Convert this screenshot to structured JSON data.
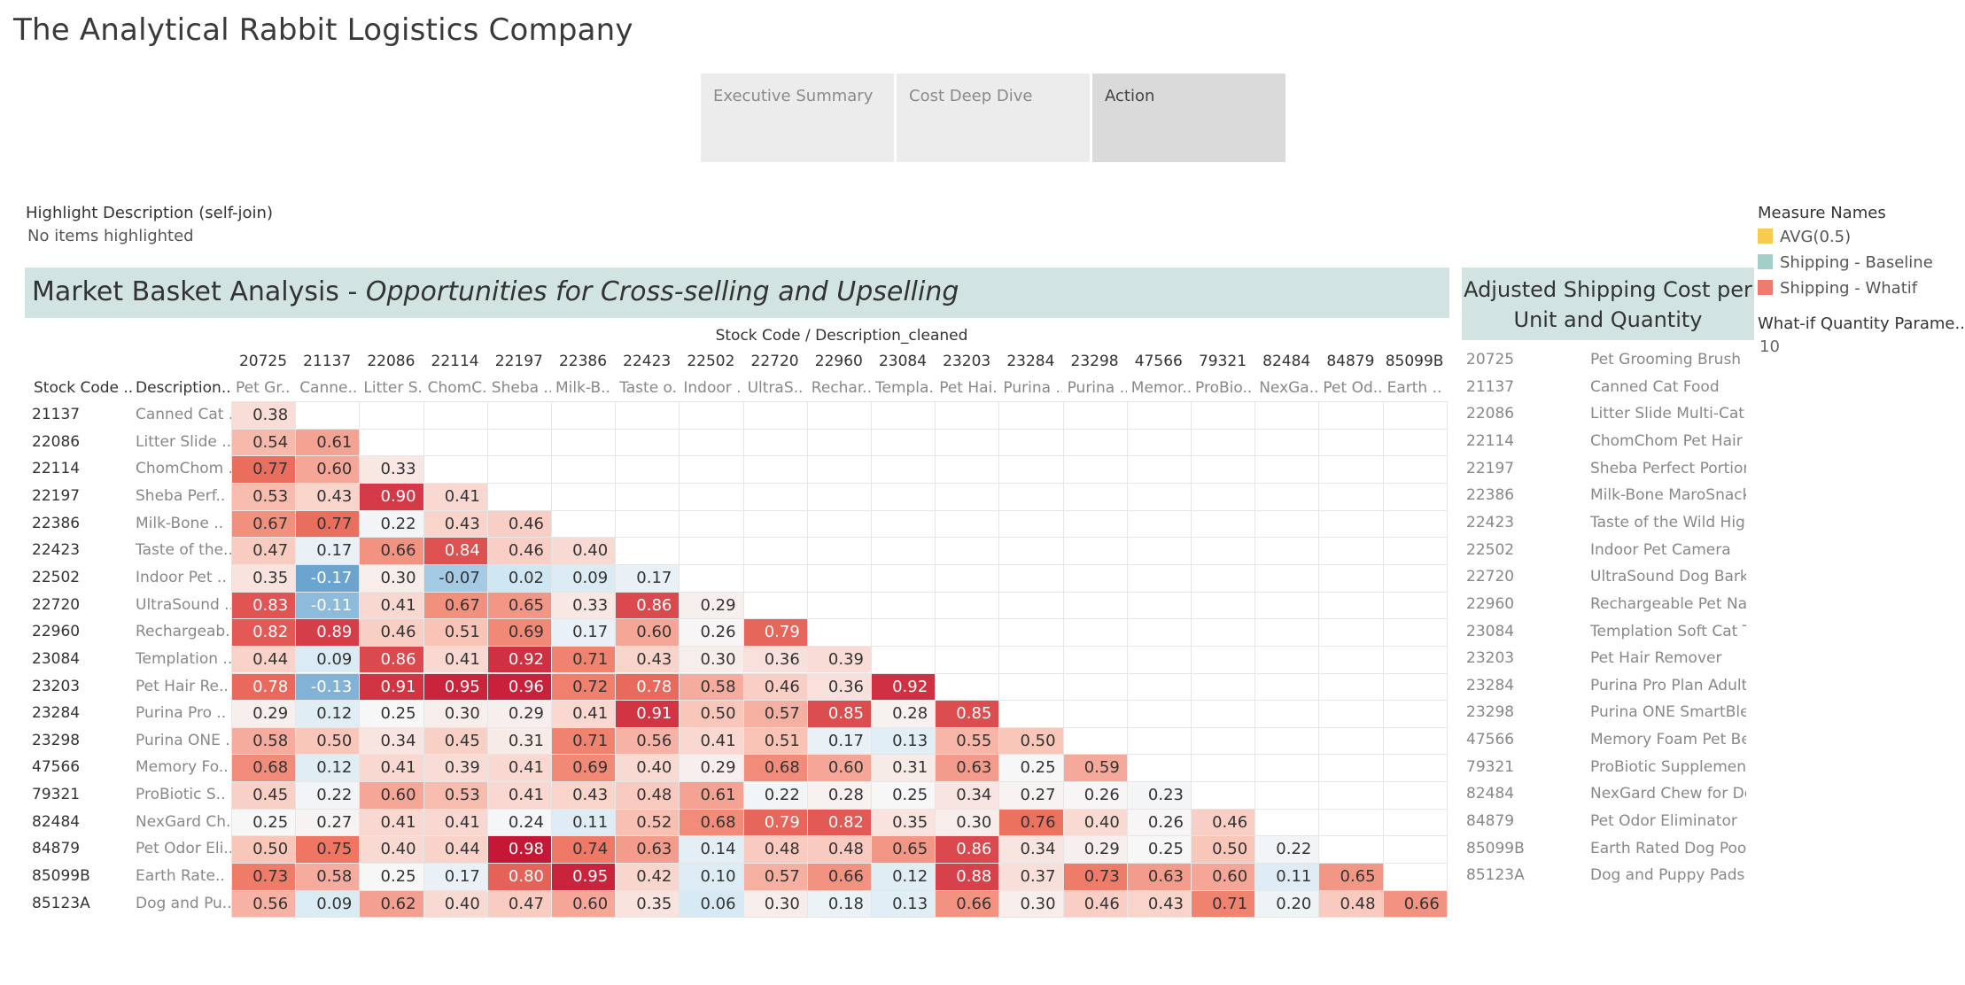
{
  "app_title": "The Analytical Rabbit Logistics Company",
  "nav_tabs": [
    {
      "label": "Executive Summary",
      "active": false
    },
    {
      "label": "Cost Deep Dive",
      "active": false
    },
    {
      "label": "Action",
      "active": true
    }
  ],
  "highlight": {
    "label": "Highlight Description (self-join)",
    "value": "No items highlighted"
  },
  "mba_banner": {
    "title": "Market Basket Analysis - ",
    "subtitle": "Opportunities for Cross-selling and Upselling"
  },
  "shipping_banner": {
    "line1": "Adjusted Shipping Cost per",
    "line2": "Unit and Quantity"
  },
  "legend": {
    "title": "Measure Names",
    "items": [
      {
        "label": "AVG(0.5)",
        "color": "#f6cb4e"
      },
      {
        "label": "Shipping - Baseline",
        "color": "#a3cfc9"
      },
      {
        "label": "Shipping - Whatif",
        "color": "#ef7b6f"
      }
    ]
  },
  "parameter": {
    "title": "What-if Quantity Parame..",
    "value": "10"
  },
  "matrix": {
    "axis_title": "Stock Code  /  Description_cleaned",
    "row_header_code": "Stock Code ..",
    "row_header_desc": "Description..",
    "columns": [
      {
        "code": "20725",
        "desc": "Pet Gr.."
      },
      {
        "code": "21137",
        "desc": "Canne.."
      },
      {
        "code": "22086",
        "desc": "Litter S.."
      },
      {
        "code": "22114",
        "desc": "ChomC.."
      },
      {
        "code": "22197",
        "desc": "Sheba .."
      },
      {
        "code": "22386",
        "desc": "Milk-B.."
      },
      {
        "code": "22423",
        "desc": "Taste o.."
      },
      {
        "code": "22502",
        "desc": "Indoor .."
      },
      {
        "code": "22720",
        "desc": "UltraS.."
      },
      {
        "code": "22960",
        "desc": "Rechar.."
      },
      {
        "code": "23084",
        "desc": "Templa.."
      },
      {
        "code": "23203",
        "desc": "Pet Hai.."
      },
      {
        "code": "23284",
        "desc": "Purina .."
      },
      {
        "code": "23298",
        "desc": "Purina .."
      },
      {
        "code": "47566",
        "desc": "Memor.."
      },
      {
        "code": "79321",
        "desc": "ProBio.."
      },
      {
        "code": "82484",
        "desc": "NexGa.."
      },
      {
        "code": "84879",
        "desc": "Pet Od.."
      },
      {
        "code": "85099B",
        "desc": "Earth .."
      }
    ],
    "rows": [
      {
        "code": "21137",
        "desc": "Canned Cat ..",
        "values": [
          "0.38"
        ]
      },
      {
        "code": "22086",
        "desc": "Litter Slide ..",
        "values": [
          "0.54",
          "0.61"
        ]
      },
      {
        "code": "22114",
        "desc": "ChomChom ..",
        "values": [
          "0.77",
          "0.60",
          "0.33"
        ]
      },
      {
        "code": "22197",
        "desc": "Sheba Perf..",
        "values": [
          "0.53",
          "0.43",
          "0.90",
          "0.41"
        ]
      },
      {
        "code": "22386",
        "desc": "Milk-Bone ..",
        "values": [
          "0.67",
          "0.77",
          "0.22",
          "0.43",
          "0.46"
        ]
      },
      {
        "code": "22423",
        "desc": "Taste of the..",
        "values": [
          "0.47",
          "0.17",
          "0.66",
          "0.84",
          "0.46",
          "0.40"
        ]
      },
      {
        "code": "22502",
        "desc": "Indoor Pet ..",
        "values": [
          "0.35",
          "-0.17",
          "0.30",
          "-0.07",
          "0.02",
          "0.09",
          "0.17"
        ]
      },
      {
        "code": "22720",
        "desc": "UltraSound ..",
        "values": [
          "0.83",
          "-0.11",
          "0.41",
          "0.67",
          "0.65",
          "0.33",
          "0.86",
          "0.29"
        ]
      },
      {
        "code": "22960",
        "desc": "Rechargeab..",
        "values": [
          "0.82",
          "0.89",
          "0.46",
          "0.51",
          "0.69",
          "0.17",
          "0.60",
          "0.26",
          "0.79"
        ]
      },
      {
        "code": "23084",
        "desc": "Templation ..",
        "values": [
          "0.44",
          "0.09",
          "0.86",
          "0.41",
          "0.92",
          "0.71",
          "0.43",
          "0.30",
          "0.36",
          "0.39"
        ]
      },
      {
        "code": "23203",
        "desc": "Pet Hair Re..",
        "values": [
          "0.78",
          "-0.13",
          "0.91",
          "0.95",
          "0.96",
          "0.72",
          "0.78",
          "0.58",
          "0.46",
          "0.36",
          "0.92"
        ]
      },
      {
        "code": "23284",
        "desc": "Purina Pro ..",
        "values": [
          "0.29",
          "0.12",
          "0.25",
          "0.30",
          "0.29",
          "0.41",
          "0.91",
          "0.50",
          "0.57",
          "0.85",
          "0.28",
          "0.85"
        ]
      },
      {
        "code": "23298",
        "desc": "Purina ONE ..",
        "values": [
          "0.58",
          "0.50",
          "0.34",
          "0.45",
          "0.31",
          "0.71",
          "0.56",
          "0.41",
          "0.51",
          "0.17",
          "0.13",
          "0.55",
          "0.50"
        ]
      },
      {
        "code": "47566",
        "desc": "Memory Fo..",
        "values": [
          "0.68",
          "0.12",
          "0.41",
          "0.39",
          "0.41",
          "0.69",
          "0.40",
          "0.29",
          "0.68",
          "0.60",
          "0.31",
          "0.63",
          "0.25",
          "0.59"
        ]
      },
      {
        "code": "79321",
        "desc": "ProBiotic S..",
        "values": [
          "0.45",
          "0.22",
          "0.60",
          "0.53",
          "0.41",
          "0.43",
          "0.48",
          "0.61",
          "0.22",
          "0.28",
          "0.25",
          "0.34",
          "0.27",
          "0.26",
          "0.23"
        ]
      },
      {
        "code": "82484",
        "desc": "NexGard Ch..",
        "values": [
          "0.25",
          "0.27",
          "0.41",
          "0.41",
          "0.24",
          "0.11",
          "0.52",
          "0.68",
          "0.79",
          "0.82",
          "0.35",
          "0.30",
          "0.76",
          "0.40",
          "0.26",
          "0.46"
        ]
      },
      {
        "code": "84879",
        "desc": "Pet Odor Eli..",
        "values": [
          "0.50",
          "0.75",
          "0.40",
          "0.44",
          "0.98",
          "0.74",
          "0.63",
          "0.14",
          "0.48",
          "0.48",
          "0.65",
          "0.86",
          "0.34",
          "0.29",
          "0.25",
          "0.50",
          "0.22"
        ]
      },
      {
        "code": "85099B",
        "desc": "Earth Rate..",
        "values": [
          "0.73",
          "0.58",
          "0.25",
          "0.17",
          "0.80",
          "0.95",
          "0.42",
          "0.10",
          "0.57",
          "0.66",
          "0.12",
          "0.88",
          "0.37",
          "0.73",
          "0.63",
          "0.60",
          "0.11",
          "0.65"
        ]
      },
      {
        "code": "85123A",
        "desc": "Dog and Pu..",
        "values": [
          "0.56",
          "0.09",
          "0.62",
          "0.40",
          "0.47",
          "0.60",
          "0.35",
          "0.06",
          "0.30",
          "0.18",
          "0.13",
          "0.66",
          "0.30",
          "0.46",
          "0.43",
          "0.71",
          "0.20",
          "0.48",
          "0.66"
        ]
      }
    ]
  },
  "shipping_list": [
    {
      "code": "20725",
      "desc": "Pet Grooming Brush"
    },
    {
      "code": "21137",
      "desc": "Canned Cat Food"
    },
    {
      "code": "22086",
      "desc": "Litter Slide Multi-Cat Size"
    },
    {
      "code": "22114",
      "desc": "ChomChom Pet Hair Remover"
    },
    {
      "code": "22197",
      "desc": "Sheba Perfect Portions"
    },
    {
      "code": "22386",
      "desc": "Milk-Bone MaroSnacks"
    },
    {
      "code": "22423",
      "desc": "Taste of the Wild High Prairie"
    },
    {
      "code": "22502",
      "desc": "Indoor Pet Camera"
    },
    {
      "code": "22720",
      "desc": "UltraSound Dog Barking Control"
    },
    {
      "code": "22960",
      "desc": "Rechargeable Pet Nail Grinder"
    },
    {
      "code": "23084",
      "desc": "Templation Soft Cat Treats"
    },
    {
      "code": "23203",
      "desc": "Pet Hair Remover"
    },
    {
      "code": "23284",
      "desc": "Purina Pro Plan Adult"
    },
    {
      "code": "23298",
      "desc": "Purina ONE SmartBlend"
    },
    {
      "code": "47566",
      "desc": "Memory Foam Pet Bed"
    },
    {
      "code": "79321",
      "desc": "ProBiotic Supplement"
    },
    {
      "code": "82484",
      "desc": "NexGard Chew for Dogs"
    },
    {
      "code": "84879",
      "desc": "Pet Odor Eliminator"
    },
    {
      "code": "85099B",
      "desc": "Earth Rated Dog Poop Bags"
    },
    {
      "code": "85123A",
      "desc": "Dog and Puppy Pads"
    }
  ]
}
